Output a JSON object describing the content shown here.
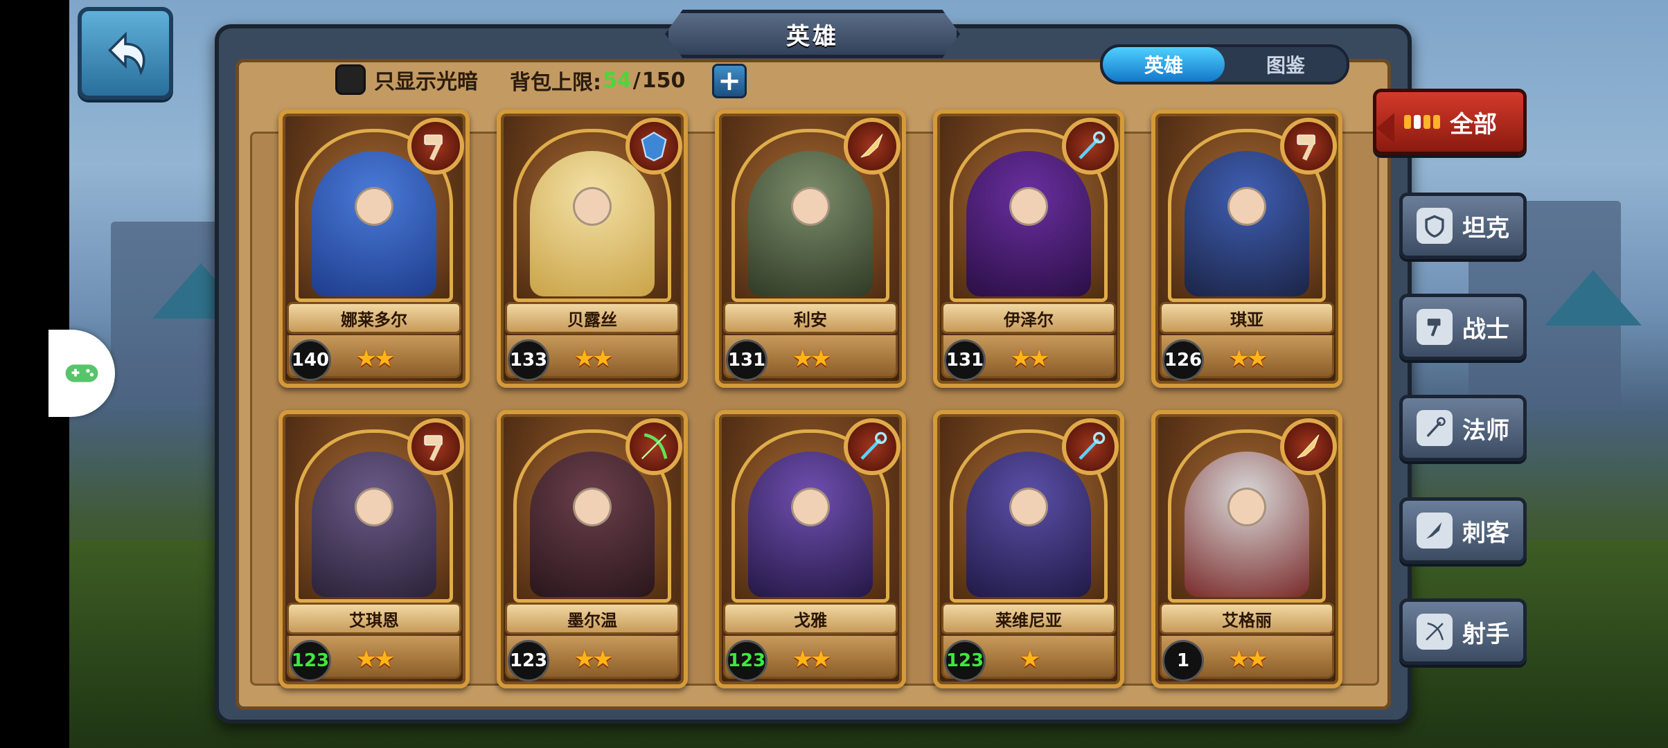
{
  "title": "英雄",
  "filter": {
    "label": "只显示光暗",
    "checked": false
  },
  "capacity": {
    "label": "背包上限:",
    "current": "54",
    "sep": "/",
    "max": "150"
  },
  "tabs": [
    {
      "label": "英雄",
      "active": true
    },
    {
      "label": "图鉴",
      "active": false
    }
  ],
  "side_filters": [
    {
      "label": "全部",
      "icon": "grid-icon",
      "active": true
    },
    {
      "label": "坦克",
      "icon": "shield-icon",
      "active": false
    },
    {
      "label": "战士",
      "icon": "hammer-icon",
      "active": false
    },
    {
      "label": "法师",
      "icon": "staff-icon",
      "active": false
    },
    {
      "label": "刺客",
      "icon": "dagger-icon",
      "active": false
    },
    {
      "label": "射手",
      "icon": "bow-icon",
      "active": false
    }
  ],
  "heroes": [
    {
      "name": "娜莱多尔",
      "level": "140",
      "stars": "★★",
      "class_icon": "hammer-icon",
      "level_color": "white"
    },
    {
      "name": "贝露丝",
      "level": "133",
      "stars": "★★",
      "class_icon": "shield-icon",
      "level_color": "white"
    },
    {
      "name": "利安",
      "level": "131",
      "stars": "★★",
      "class_icon": "dagger-icon",
      "level_color": "white"
    },
    {
      "name": "伊泽尔",
      "level": "131",
      "stars": "★★",
      "class_icon": "staff-icon",
      "level_color": "white"
    },
    {
      "name": "琪亚",
      "level": "126",
      "stars": "★★",
      "class_icon": "hammer-icon",
      "level_color": "white"
    },
    {
      "name": "艾琪恩",
      "level": "123",
      "stars": "★★",
      "class_icon": "hammer-icon",
      "level_color": "green"
    },
    {
      "name": "墨尔温",
      "level": "123",
      "stars": "★★",
      "class_icon": "bow-icon",
      "level_color": "white"
    },
    {
      "name": "戈雅",
      "level": "123",
      "stars": "★★",
      "class_icon": "staff-icon",
      "level_color": "green"
    },
    {
      "name": "莱维尼亚",
      "level": "123",
      "stars": "★",
      "class_icon": "staff-icon",
      "level_color": "green"
    },
    {
      "name": "艾格丽",
      "level": "1",
      "stars": "★★",
      "class_icon": "dagger-icon",
      "level_color": "white"
    }
  ]
}
